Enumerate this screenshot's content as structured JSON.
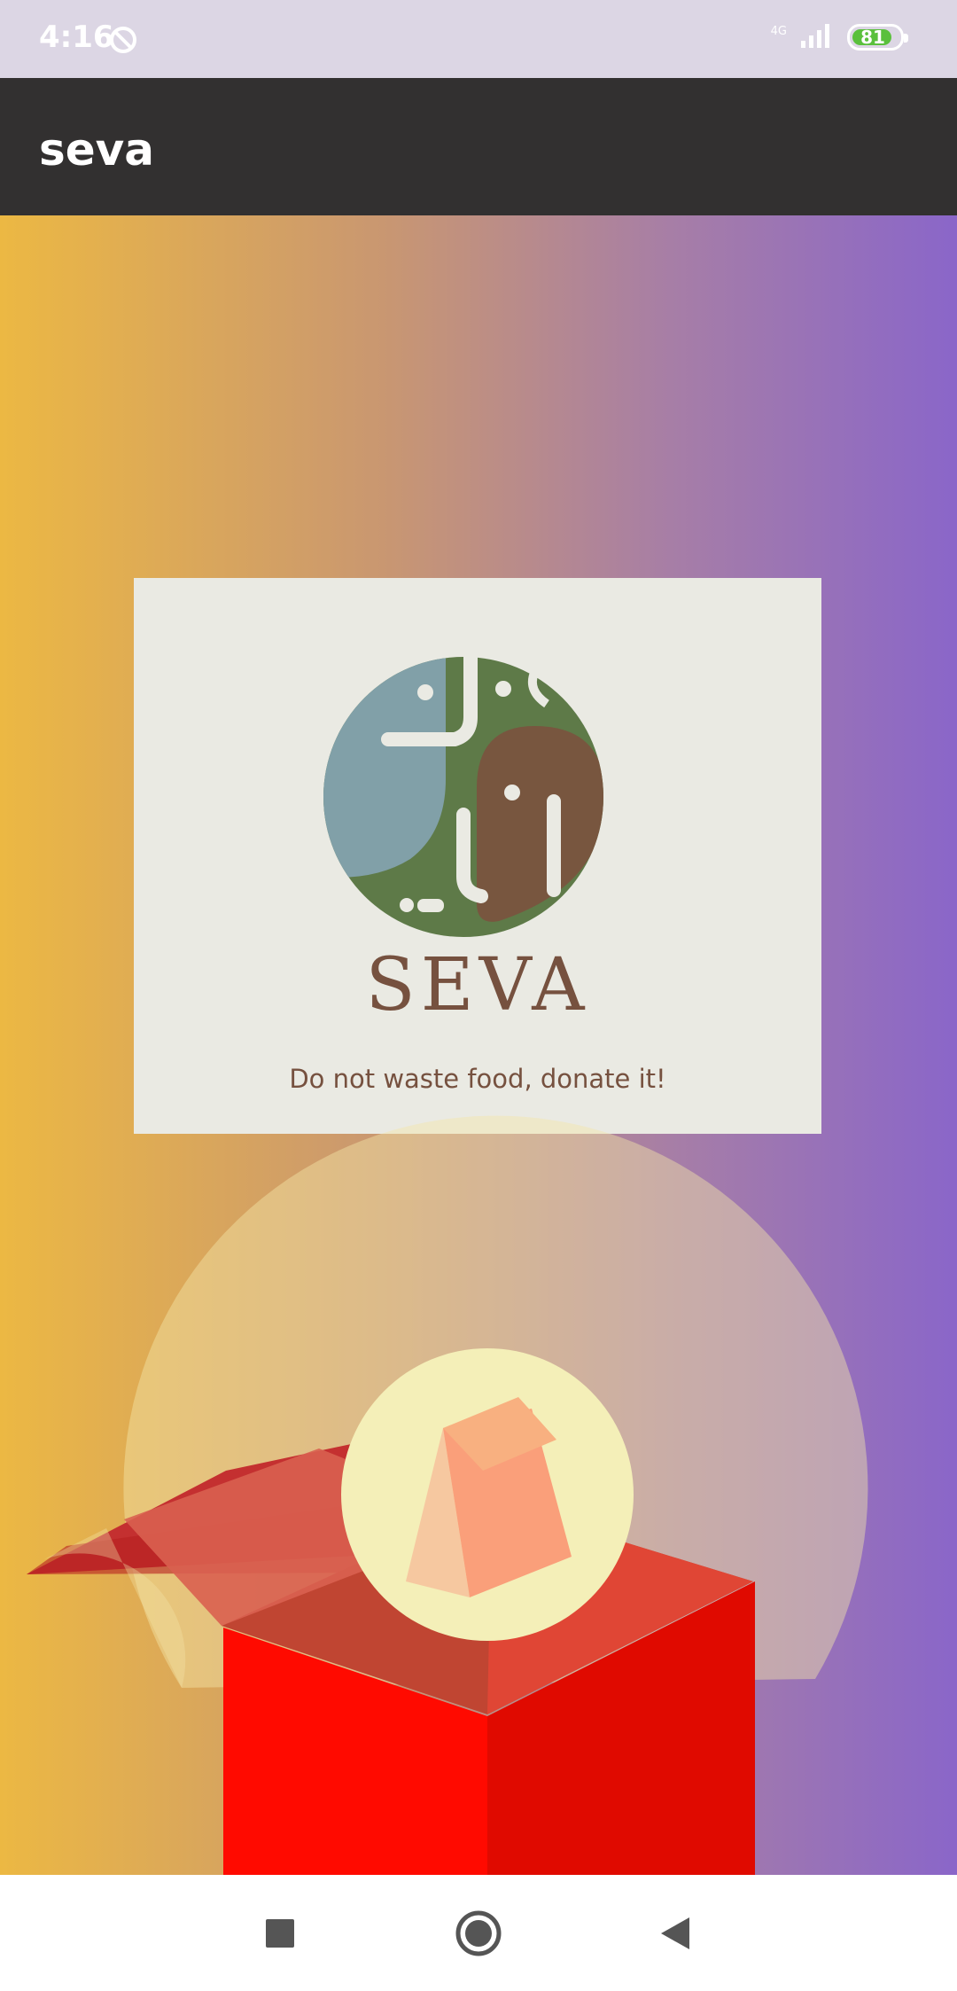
{
  "status_bar": {
    "time": "4:16",
    "network": "4G",
    "battery": "81",
    "sync_icon": "sync-off-icon",
    "signal_icon": "signal-icon"
  },
  "app_bar": {
    "title": "seva"
  },
  "logo": {
    "wordmark": "SEVA",
    "tagline": "Do not waste food, donate it!",
    "colors": {
      "blue": "#81a0a8",
      "green": "#5e7a48",
      "brown": "#78563f",
      "card": "#eaeae3"
    }
  },
  "illustration": {
    "description_icon": "donation-box-icon"
  },
  "nav_bar": {
    "recents_icon": "square-icon",
    "home_icon": "circle-icon",
    "back_icon": "triangle-back-icon"
  },
  "colors": {
    "gradient_start": "#ecb843",
    "gradient_end": "#8a66c9",
    "app_bar": "#323030",
    "status_bar": "#dcd6e4"
  }
}
